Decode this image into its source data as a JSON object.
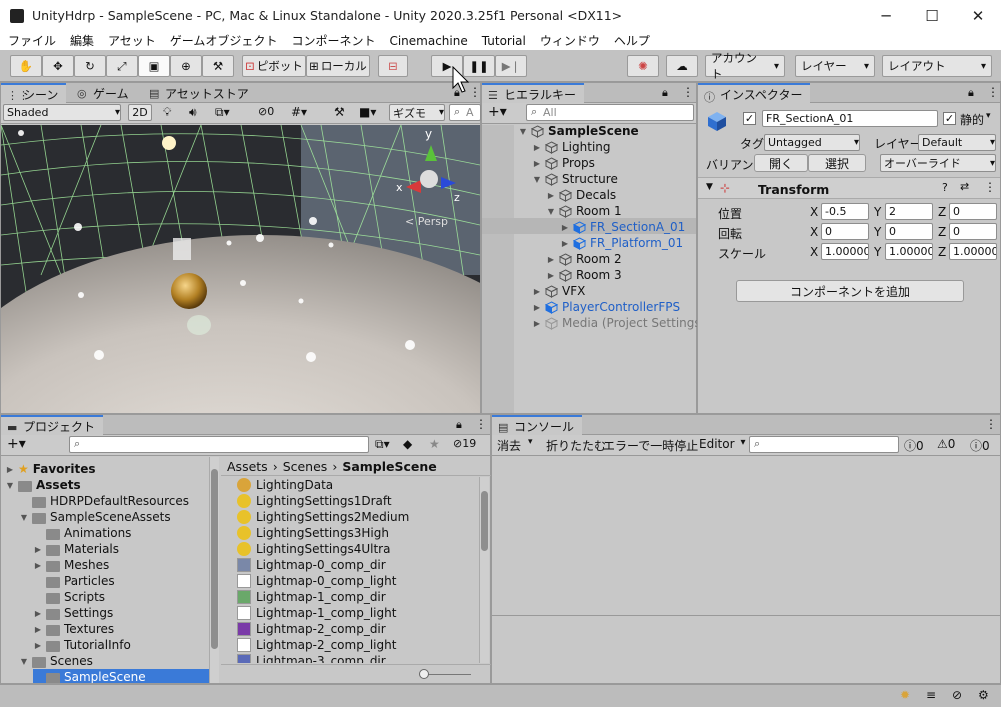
{
  "window": {
    "title": "UnityHdrp - SampleScene - PC, Mac & Linux Standalone - Unity 2020.3.25f1 Personal <DX11>",
    "minimize": "─",
    "maximize": "☐",
    "close": "✕"
  },
  "menu": [
    "ファイル",
    "編集",
    "アセット",
    "ゲームオブジェクト",
    "コンポーネント",
    "Cinemachine",
    "Tutorial",
    "ウィンドウ",
    "ヘルプ"
  ],
  "toolbar": {
    "pivot": "ピボット",
    "local": "ローカル",
    "account": "アカウント",
    "layers": "レイヤー",
    "layout": "レイアウト"
  },
  "scene": {
    "tabs": [
      "シーン",
      "ゲーム",
      "アセットストア"
    ],
    "shading": "Shaded",
    "mode2d": "2D",
    "fx_count": "0",
    "gizmos": "ギズモ",
    "search_placeholder": "A",
    "persp": "< Persp",
    "axis_y": "y",
    "axis_x": "x",
    "axis_z": "z"
  },
  "hierarchy": {
    "tab": "ヒエラルキー",
    "search_placeholder": "All",
    "items": [
      {
        "label": "SampleScene",
        "depth": 0,
        "exp": "▼",
        "style": "bold"
      },
      {
        "label": "Lighting",
        "depth": 1,
        "exp": "▶",
        "style": ""
      },
      {
        "label": "Props",
        "depth": 1,
        "exp": "▶",
        "style": ""
      },
      {
        "label": "Structure",
        "depth": 1,
        "exp": "▼",
        "style": ""
      },
      {
        "label": "Decals",
        "depth": 2,
        "exp": "▶",
        "style": ""
      },
      {
        "label": "Room 1",
        "depth": 2,
        "exp": "▼",
        "style": ""
      },
      {
        "label": "FR_SectionA_01",
        "depth": 3,
        "exp": "▶",
        "style": "blue"
      },
      {
        "label": "FR_Platform_01",
        "depth": 3,
        "exp": "▶",
        "style": "blue"
      },
      {
        "label": "Room 2",
        "depth": 2,
        "exp": "▶",
        "style": ""
      },
      {
        "label": "Room 3",
        "depth": 2,
        "exp": "▶",
        "style": ""
      },
      {
        "label": "VFX",
        "depth": 1,
        "exp": "▶",
        "style": ""
      },
      {
        "label": "PlayerControllerFPS",
        "depth": 1,
        "exp": "▶",
        "style": "blue"
      },
      {
        "label": "Media (Project Settings)",
        "depth": 1,
        "exp": "▶",
        "style": "gray"
      }
    ]
  },
  "inspector": {
    "tab": "インスペクター",
    "object_name": "FR_SectionA_01",
    "static_label": "静的",
    "tag_label": "タグ",
    "tag_value": "Untagged",
    "layer_label": "レイヤー",
    "layer_value": "Default",
    "variant_label": "バリアント",
    "open_button": "開く",
    "select_button": "選択",
    "override_button": "オーバーライド",
    "transform_title": "Transform",
    "position_label": "位置",
    "rotation_label": "回転",
    "scale_label": "スケール",
    "position": {
      "x": "-0.5",
      "y": "2",
      "z": "0"
    },
    "rotation": {
      "x": "0",
      "y": "0",
      "z": "0"
    },
    "scale": {
      "x": "1.00000",
      "y": "1.00000",
      "z": "1.00000"
    },
    "add_component": "コンポーネントを追加"
  },
  "project": {
    "tab": "プロジェクト",
    "badge_count": "19",
    "tree": [
      {
        "label": "Favorites",
        "depth": 0,
        "exp": "▶",
        "style": "bold",
        "icon": "star"
      },
      {
        "label": "Assets",
        "depth": 0,
        "exp": "▼",
        "style": "bold",
        "icon": "folder"
      },
      {
        "label": "HDRPDefaultResources",
        "depth": 1,
        "exp": "",
        "style": "",
        "icon": "folder"
      },
      {
        "label": "SampleSceneAssets",
        "depth": 1,
        "exp": "▼",
        "style": "",
        "icon": "folder"
      },
      {
        "label": "Animations",
        "depth": 2,
        "exp": "",
        "style": "",
        "icon": "folder"
      },
      {
        "label": "Materials",
        "depth": 2,
        "exp": "▶",
        "style": "",
        "icon": "folder"
      },
      {
        "label": "Meshes",
        "depth": 2,
        "exp": "▶",
        "style": "",
        "icon": "folder"
      },
      {
        "label": "Particles",
        "depth": 2,
        "exp": "",
        "style": "",
        "icon": "folder"
      },
      {
        "label": "Scripts",
        "depth": 2,
        "exp": "",
        "style": "",
        "icon": "folder"
      },
      {
        "label": "Settings",
        "depth": 2,
        "exp": "▶",
        "style": "",
        "icon": "folder"
      },
      {
        "label": "Textures",
        "depth": 2,
        "exp": "▶",
        "style": "",
        "icon": "folder"
      },
      {
        "label": "TutorialInfo",
        "depth": 2,
        "exp": "▶",
        "style": "",
        "icon": "folder"
      },
      {
        "label": "Scenes",
        "depth": 1,
        "exp": "▼",
        "style": "",
        "icon": "folder"
      },
      {
        "label": "SampleScene",
        "depth": 2,
        "exp": "",
        "style": "",
        "icon": "folder"
      }
    ],
    "breadcrumb": [
      "Assets",
      "Scenes",
      "SampleScene"
    ],
    "files": [
      {
        "label": "LightingData",
        "icon": "lighting-data",
        "color": "#d9a43a"
      },
      {
        "label": "LightingSettings1Draft",
        "icon": "lighting-settings",
        "color": "#e8c22a"
      },
      {
        "label": "LightingSettings2Medium",
        "icon": "lighting-settings",
        "color": "#e8c22a"
      },
      {
        "label": "LightingSettings3High",
        "icon": "lighting-settings",
        "color": "#e8c22a"
      },
      {
        "label": "LightingSettings4Ultra",
        "icon": "lighting-settings",
        "color": "#e8c22a"
      },
      {
        "label": "Lightmap-0_comp_dir",
        "icon": "lightmap-dir",
        "color": "#7a88a8"
      },
      {
        "label": "Lightmap-0_comp_light",
        "icon": "lightmap-light",
        "color": "#ffffff"
      },
      {
        "label": "Lightmap-1_comp_dir",
        "icon": "lightmap-dir",
        "color": "#6aa86a"
      },
      {
        "label": "Lightmap-1_comp_light",
        "icon": "lightmap-light",
        "color": "#ffffff"
      },
      {
        "label": "Lightmap-2_comp_dir",
        "icon": "lightmap-dir",
        "color": "#7a3aa8"
      },
      {
        "label": "Lightmap-2_comp_light",
        "icon": "lightmap-light",
        "color": "#ffffff"
      },
      {
        "label": "Lightmap-3_comp_dir",
        "icon": "lightmap-dir",
        "color": "#5a6ab8"
      }
    ]
  },
  "console": {
    "tab": "コンソール",
    "clear": "消去",
    "collapse": "折りたたむ",
    "error_pause": "エラーで一時停止",
    "editor": "Editor",
    "log_count": "0",
    "warn_count": "0",
    "error_count": "0"
  },
  "colors": {
    "accent": "#3a7ad8",
    "selection": "#9cb4d8",
    "prefab_blue": "#1f5fc7"
  }
}
